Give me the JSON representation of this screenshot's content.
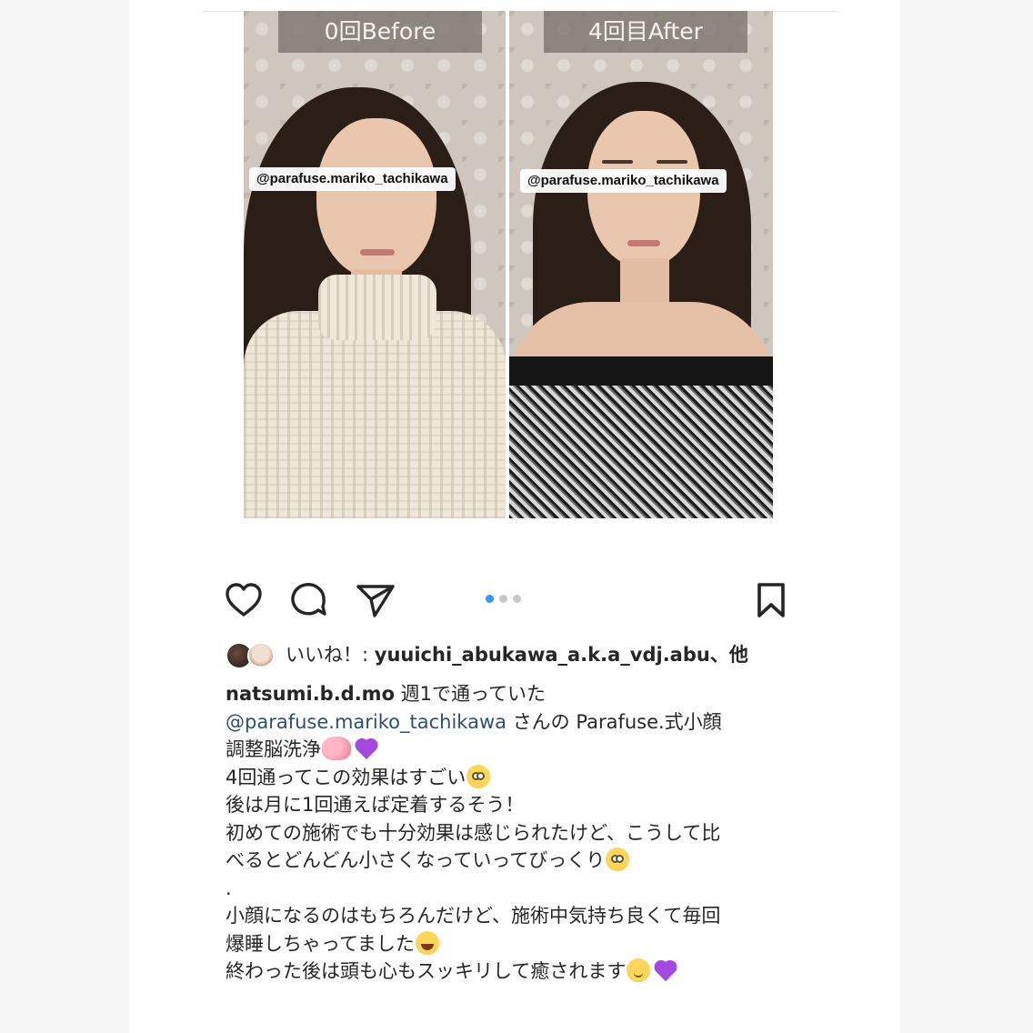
{
  "post": {
    "images": {
      "before_label": "0回Before",
      "after_label": "4回目After",
      "watermark": "@parafuse.mariko_tachikawa"
    },
    "carousel": {
      "count": 3,
      "active": 1
    },
    "likes": {
      "prefix": "いいね！: ",
      "name": "yuuichi_abukawa_a.k.a_vdj.abu",
      "suffix": "、他"
    },
    "caption": {
      "username": "natsumi.b.d.mo",
      "l1_text": " 週1で通っていた",
      "mention": "@parafuse.mariko_tachikawa",
      "l2_text": " さんの Parafuse.式小顔",
      "l3_text": "調整脳洗浄",
      "l4_text": "4回通ってこの効果はすごい",
      "l5_text": "後は月に1回通えば定着するそう！",
      "l6_text": "初めての施術でも十分効果は感じられたけど、こうして比",
      "l7_text": "べるとどんどん小さくなっていってびっくり",
      "l8_text": ".",
      "l9_text": "小顔になるのはもちろんだけど、施術中気持ち良くて毎回",
      "l10_text": "爆睡しちゃってました",
      "l11_text": "終わった後は頭も心もスッキリして癒されます"
    }
  },
  "icons": {
    "like": "heart-outline-icon",
    "comment": "comment-bubble-icon",
    "share": "paper-plane-icon",
    "save": "bookmark-icon"
  },
  "colors": {
    "text": "#262626",
    "mention": "#2e4e73",
    "active_dot": "#3897f0",
    "inactive_dot": "#c8c8c8"
  }
}
